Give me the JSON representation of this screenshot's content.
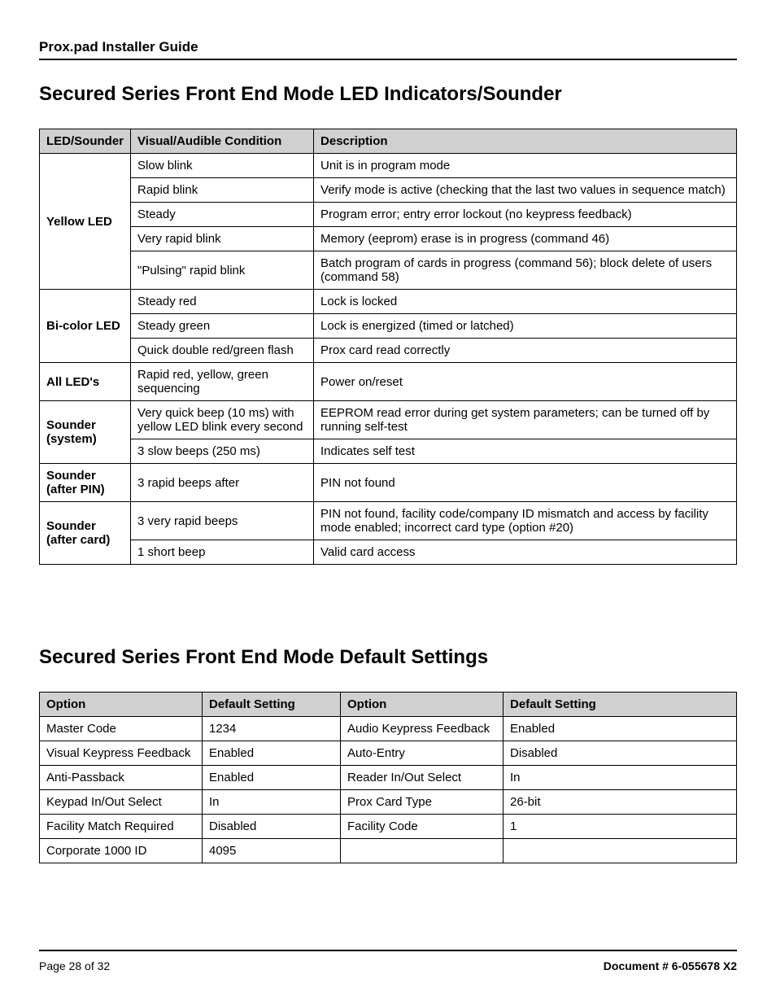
{
  "header": {
    "guide_title": "Prox.pad Installer Guide"
  },
  "section1": {
    "heading": "Secured Series Front End Mode LED Indicators/Sounder",
    "columns": {
      "led": "LED/Sounder",
      "visual": "Visual/Audible Condition",
      "desc": "Description"
    },
    "groups": [
      {
        "label": "Yellow LED",
        "rows": [
          {
            "visual": "Slow blink",
            "desc": "Unit is in program mode"
          },
          {
            "visual": "Rapid blink",
            "desc": "Verify mode is active (checking that the last two values in sequence match)"
          },
          {
            "visual": "Steady",
            "desc": "Program error; entry error lockout (no keypress feedback)"
          },
          {
            "visual": "Very rapid blink",
            "desc": "Memory (eeprom) erase is in progress (command 46)"
          },
          {
            "visual": "\"Pulsing\" rapid blink",
            "desc": "Batch program of cards in progress (command 56); block delete of users (command 58)"
          }
        ]
      },
      {
        "label": "Bi-color LED",
        "rows": [
          {
            "visual": "Steady red",
            "desc": "Lock is locked"
          },
          {
            "visual": "Steady green",
            "desc": "Lock is energized (timed or latched)"
          },
          {
            "visual": "Quick double red/green flash",
            "desc": "Prox card read correctly"
          }
        ]
      },
      {
        "label": "All LED's",
        "rows": [
          {
            "visual": "Rapid red, yellow, green sequencing",
            "desc": "Power on/reset"
          }
        ]
      },
      {
        "label": "Sounder (system)",
        "rows": [
          {
            "visual": "Very quick beep (10 ms) with yellow LED blink every second",
            "desc": "EEPROM read error during get system parameters; can be turned off by running self-test"
          },
          {
            "visual": "3 slow beeps (250 ms)",
            "desc": "Indicates self test"
          }
        ]
      },
      {
        "label": "Sounder (after PIN)",
        "rows": [
          {
            "visual": "3 rapid beeps after",
            "desc": "PIN not found"
          }
        ]
      },
      {
        "label": "Sounder (after card)",
        "rows": [
          {
            "visual": "3 very rapid beeps",
            "desc": "PIN not found, facility code/company ID mismatch and access by facility mode enabled; incorrect card type (option #20)"
          },
          {
            "visual": "1 short beep",
            "desc": "Valid card access"
          }
        ]
      }
    ]
  },
  "section2": {
    "heading": "Secured Series Front End Mode Default Settings",
    "columns": {
      "option": "Option",
      "default": "Default Setting"
    },
    "rows": [
      {
        "o1": "Master Code",
        "d1": "1234",
        "o2": "Audio Keypress Feedback",
        "d2": "Enabled"
      },
      {
        "o1": "Visual Keypress Feedback",
        "d1": "Enabled",
        "o2": "Auto-Entry",
        "d2": "Disabled"
      },
      {
        "o1": "Anti-Passback",
        "d1": "Enabled",
        "o2": "Reader In/Out Select",
        "d2": "In"
      },
      {
        "o1": "Keypad In/Out Select",
        "d1": "In",
        "o2": "Prox Card Type",
        "d2": "26-bit"
      },
      {
        "o1": "Facility Match Required",
        "d1": "Disabled",
        "o2": "Facility Code",
        "d2": "1"
      },
      {
        "o1": "Corporate 1000 ID",
        "d1": "4095",
        "o2": "",
        "d2": ""
      }
    ]
  },
  "footer": {
    "page": "Page 28 of 32",
    "doc": "Document # 6-055678 X2"
  }
}
